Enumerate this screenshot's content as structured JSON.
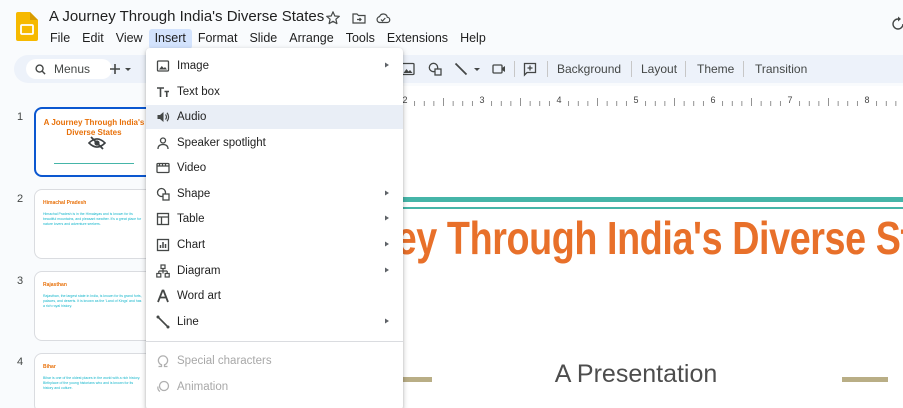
{
  "doc": {
    "title": "A Journey Through India's Diverse States"
  },
  "menubar": {
    "items": [
      {
        "label": "File"
      },
      {
        "label": "Edit"
      },
      {
        "label": "View"
      },
      {
        "label": "Insert",
        "active": true
      },
      {
        "label": "Format"
      },
      {
        "label": "Slide"
      },
      {
        "label": "Arrange"
      },
      {
        "label": "Tools"
      },
      {
        "label": "Extensions"
      },
      {
        "label": "Help"
      }
    ]
  },
  "toolbar": {
    "search_label": "Menus",
    "background_label": "Background",
    "layout_label": "Layout",
    "theme_label": "Theme",
    "transition_label": "Transition"
  },
  "ruler": {
    "labels": [
      "2",
      "3",
      "4",
      "5",
      "6",
      "7",
      "8"
    ]
  },
  "insert_menu": {
    "items": [
      {
        "label": "Image",
        "icon": "image-icon",
        "submenu": true
      },
      {
        "label": "Text box",
        "icon": "text-box-icon",
        "submenu": false
      },
      {
        "label": "Audio",
        "icon": "audio-icon",
        "submenu": false,
        "hover": true
      },
      {
        "label": "Speaker spotlight",
        "icon": "speaker-spotlight-icon",
        "submenu": false
      },
      {
        "label": "Video",
        "icon": "video-icon",
        "submenu": false
      },
      {
        "label": "Shape",
        "icon": "shape-icon",
        "submenu": true
      },
      {
        "label": "Table",
        "icon": "table-icon",
        "submenu": true
      },
      {
        "label": "Chart",
        "icon": "chart-icon",
        "submenu": true
      },
      {
        "label": "Diagram",
        "icon": "diagram-icon",
        "submenu": true
      },
      {
        "label": "Word art",
        "icon": "word-art-icon",
        "submenu": false
      },
      {
        "label": "Line",
        "icon": "line-icon",
        "submenu": true
      },
      {
        "label": "Special characters",
        "icon": "omega-icon",
        "submenu": false,
        "disabled": true
      },
      {
        "label": "Animation",
        "icon": "animation-icon",
        "submenu": false,
        "disabled": true
      }
    ]
  },
  "slides": [
    {
      "number": "1",
      "title": "A Journey Through India's Diverse States",
      "body": ""
    },
    {
      "number": "2",
      "title": "Himachal Pradesh",
      "body": "Himachal Pradesh is in the Himalayas and is known for its beautiful mountains, and pleasant weather. It's a great place for nature lovers and adventure seekers."
    },
    {
      "number": "3",
      "title": "Rajasthan",
      "body": "Rajasthan, the largest state in India, is known for its grand forts, palaces, and deserts. It is known as the 'Land of Kings' and has a rich royal history."
    },
    {
      "number": "4",
      "title": "Bihar",
      "body": "Bihar is one of the oldest places in the world with a rich history. Birthplace of the young historians who and is known for its history and culture."
    }
  ],
  "slide_main": {
    "title": "A Journey Through India's Diverse States",
    "subtitle": "A Presentation"
  },
  "colors": {
    "accent_orange": "#e8702a",
    "teal": "#45b5a8",
    "selection_blue": "#0b57d0",
    "menu_hover": "#e9eef6"
  }
}
